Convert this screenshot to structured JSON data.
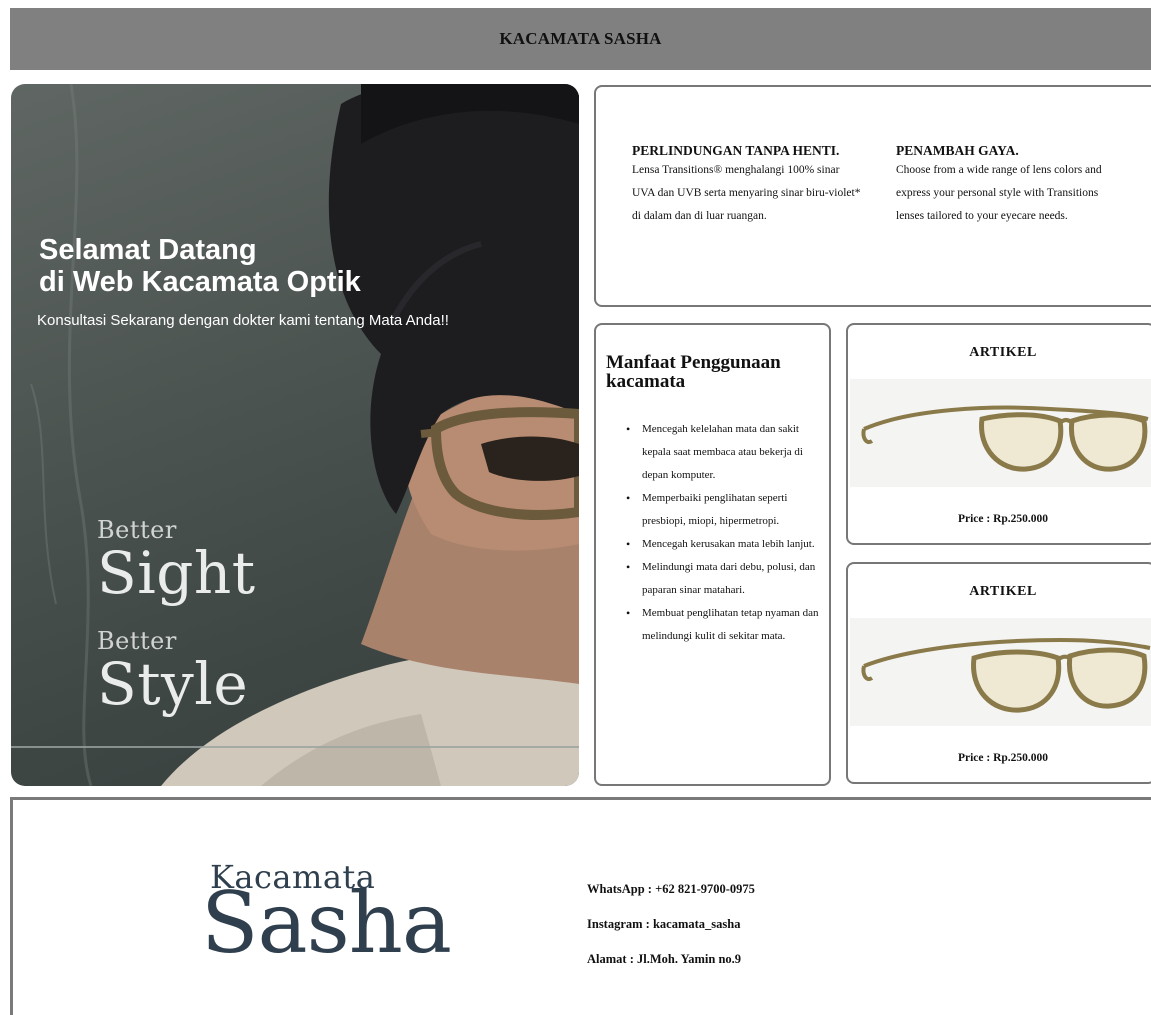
{
  "header": {
    "title": "KACAMATA SASHA"
  },
  "hero": {
    "title_line1": "Selamat Datang",
    "title_line2": "di Web Kacamata Optik",
    "subtitle": "Konsultasi Sekarang dengan dokter kami tentang Mata Anda!!",
    "tagline": [
      "Better",
      "Sight",
      "Better",
      "Style"
    ]
  },
  "info": [
    {
      "title": "PERLINDUNGAN TANPA HENTI.",
      "text": "Lensa Transitions® menghalangi 100% sinar UVA dan UVB serta menyaring sinar biru-violet* di dalam dan di luar ruangan."
    },
    {
      "title": "PENAMBAH GAYA.",
      "text": "Choose from a wide range of lens colors and express your personal style with Transitions lenses tailored to your eyecare needs."
    }
  ],
  "benefits": {
    "title": "Manfaat Penggunaan kacamata",
    "items": [
      "Mencegah kelelahan mata dan sakit kepala saat membaca atau bekerja di depan komputer.",
      "Memperbaiki penglihatan seperti presbiopi, miopi, hipermetropi.",
      "Mencegah kerusakan mata lebih lanjut.",
      "Melindungi mata dari debu, polusi, dan paparan sinar matahari.",
      "Membuat penglihatan tetap nyaman dan melindungi kulit di sekitar mata."
    ]
  },
  "products": [
    {
      "title": "ARTIKEL",
      "price": "Price : Rp.250.000",
      "image_icon": "eyeglasses-icon"
    },
    {
      "title": "ARTIKEL",
      "price": "Price : Rp.250.000",
      "image_icon": "eyeglasses-icon"
    }
  ],
  "footer": {
    "logo_small": "Kacamata",
    "logo_big": "Sasha",
    "whatsapp": "WhatsApp : +62 821-9700-0975",
    "instagram": "Instagram : kacamata_sasha",
    "address": "Alamat : Jl.Moh. Yamin no.9"
  },
  "colors": {
    "header_bg": "#808080",
    "card_border": "#777777",
    "logo": "#2f3f4e",
    "frame": "#8a7a4a"
  }
}
